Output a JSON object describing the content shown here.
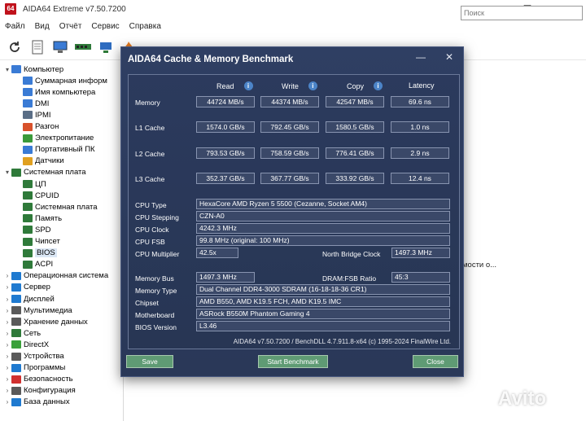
{
  "window": {
    "title": "AIDA64 Extreme v7.50.7200",
    "logo_text": "64",
    "minimize": "—",
    "maximize": "☐",
    "close": "✕"
  },
  "menu": [
    "Файл",
    "Вид",
    "Отчёт",
    "Сервис",
    "Справка"
  ],
  "search": {
    "placeholder": "Поиск"
  },
  "tree": [
    {
      "label": "Компьютер",
      "exp": "▾",
      "color": "#3a7bd5"
    },
    {
      "label": "Суммарная информ",
      "exp": "",
      "color": "#3a7bd5"
    },
    {
      "label": "Имя компьютера",
      "exp": "",
      "color": "#3a7bd5"
    },
    {
      "label": "DMI",
      "exp": "",
      "color": "#3a7bd5"
    },
    {
      "label": "IPMI",
      "exp": "",
      "color": "#5a6e86"
    },
    {
      "label": "Разгон",
      "exp": "",
      "color": "#d8512b"
    },
    {
      "label": "Электропитание",
      "exp": "",
      "color": "#3a9a3a"
    },
    {
      "label": "Портативный ПК",
      "exp": "",
      "color": "#3a7bd5"
    },
    {
      "label": "Датчики",
      "exp": "",
      "color": "#e0a020"
    },
    {
      "label": "Системная плата",
      "exp": "▾",
      "color": "#2f7a3a"
    },
    {
      "label": "ЦП",
      "exp": "",
      "color": "#2f7a3a"
    },
    {
      "label": "CPUID",
      "exp": "",
      "color": "#2f7a3a"
    },
    {
      "label": "Системная плата",
      "exp": "",
      "color": "#2f7a3a"
    },
    {
      "label": "Память",
      "exp": "",
      "color": "#2f7a3a"
    },
    {
      "label": "SPD",
      "exp": "",
      "color": "#2f7a3a"
    },
    {
      "label": "Чипсет",
      "exp": "",
      "color": "#2f7a3a"
    },
    {
      "label": "BIOS",
      "exp": "",
      "color": "#2f7a3a"
    },
    {
      "label": "ACPI",
      "exp": "",
      "color": "#2f7a3a"
    },
    {
      "label": "Операционная система",
      "exp": "›",
      "color": "#1f7ad0"
    },
    {
      "label": "Сервер",
      "exp": "›",
      "color": "#1f7ad0"
    },
    {
      "label": "Дисплей",
      "exp": "›",
      "color": "#1f7ad0"
    },
    {
      "label": "Мультимедиа",
      "exp": "›",
      "color": "#5a5a5a"
    },
    {
      "label": "Хранение данных",
      "exp": "›",
      "color": "#5a5a5a"
    },
    {
      "label": "Сеть",
      "exp": "›",
      "color": "#2f7a3a"
    },
    {
      "label": "DirectX",
      "exp": "›",
      "color": "#3aa03a"
    },
    {
      "label": "Устройства",
      "exp": "›",
      "color": "#5a5a5a"
    },
    {
      "label": "Программы",
      "exp": "›",
      "color": "#1f7ad0"
    },
    {
      "label": "Безопасность",
      "exp": "›",
      "color": "#d0302f"
    },
    {
      "label": "Конфигурация",
      "exp": "›",
      "color": "#5a5a5a"
    },
    {
      "label": "База данных",
      "exp": "›",
      "color": "#1f7ad0"
    }
  ],
  "right_pane_text": "мости о...",
  "watermark": "Avito",
  "dialog": {
    "title": "AIDA64 Cache & Memory Benchmark",
    "minimize": "—",
    "close": "✕",
    "headers": {
      "read": "Read",
      "write": "Write",
      "copy": "Copy",
      "latency": "Latency"
    },
    "info_glyph": "i",
    "rows": [
      {
        "label": "Memory",
        "read": "44724 MB/s",
        "write": "44374 MB/s",
        "copy": "42547 MB/s",
        "latency": "69.6 ns"
      },
      {
        "label": "L1 Cache",
        "read": "1574.0 GB/s",
        "write": "792.45 GB/s",
        "copy": "1580.5 GB/s",
        "latency": "1.0 ns"
      },
      {
        "label": "L2 Cache",
        "read": "793.53 GB/s",
        "write": "758.59 GB/s",
        "copy": "776.41 GB/s",
        "latency": "2.9 ns"
      },
      {
        "label": "L3 Cache",
        "read": "352.37 GB/s",
        "write": "367.77 GB/s",
        "copy": "333.92 GB/s",
        "latency": "12.4 ns"
      }
    ],
    "cpu_type_label": "CPU Type",
    "cpu_type": "HexaCore AMD Ryzen 5 5500  (Cezanne, Socket AM4)",
    "cpu_stepping_label": "CPU Stepping",
    "cpu_stepping": "CZN-A0",
    "cpu_clock_label": "CPU Clock",
    "cpu_clock": "4242.3 MHz",
    "cpu_fsb_label": "CPU FSB",
    "cpu_fsb": "99.8 MHz  (original: 100 MHz)",
    "cpu_multiplier_label": "CPU Multiplier",
    "cpu_multiplier": "42.5x",
    "nb_clock_label": "North Bridge Clock",
    "nb_clock": "1497.3 MHz",
    "memory_bus_label": "Memory Bus",
    "memory_bus": "1497.3 MHz",
    "dram_fsb_label": "DRAM:FSB Ratio",
    "dram_fsb": "45:3",
    "memory_type_label": "Memory Type",
    "memory_type": "Dual Channel DDR4-3000 SDRAM  (16-18-18-36 CR1)",
    "chipset_label": "Chipset",
    "chipset": "AMD B550, AMD K19.5 FCH, AMD K19.5 IMC",
    "motherboard_label": "Motherboard",
    "motherboard": "ASRock B550M Phantom Gaming 4",
    "bios_label": "BIOS Version",
    "bios": "L3.46",
    "footer": "AIDA64 v7.50.7200 / BenchDLL 4.7.911.8-x64  (c) 1995-2024 FinalWire Ltd.",
    "save_label": "Save",
    "start_label": "Start Benchmark",
    "close_label": "Close"
  }
}
